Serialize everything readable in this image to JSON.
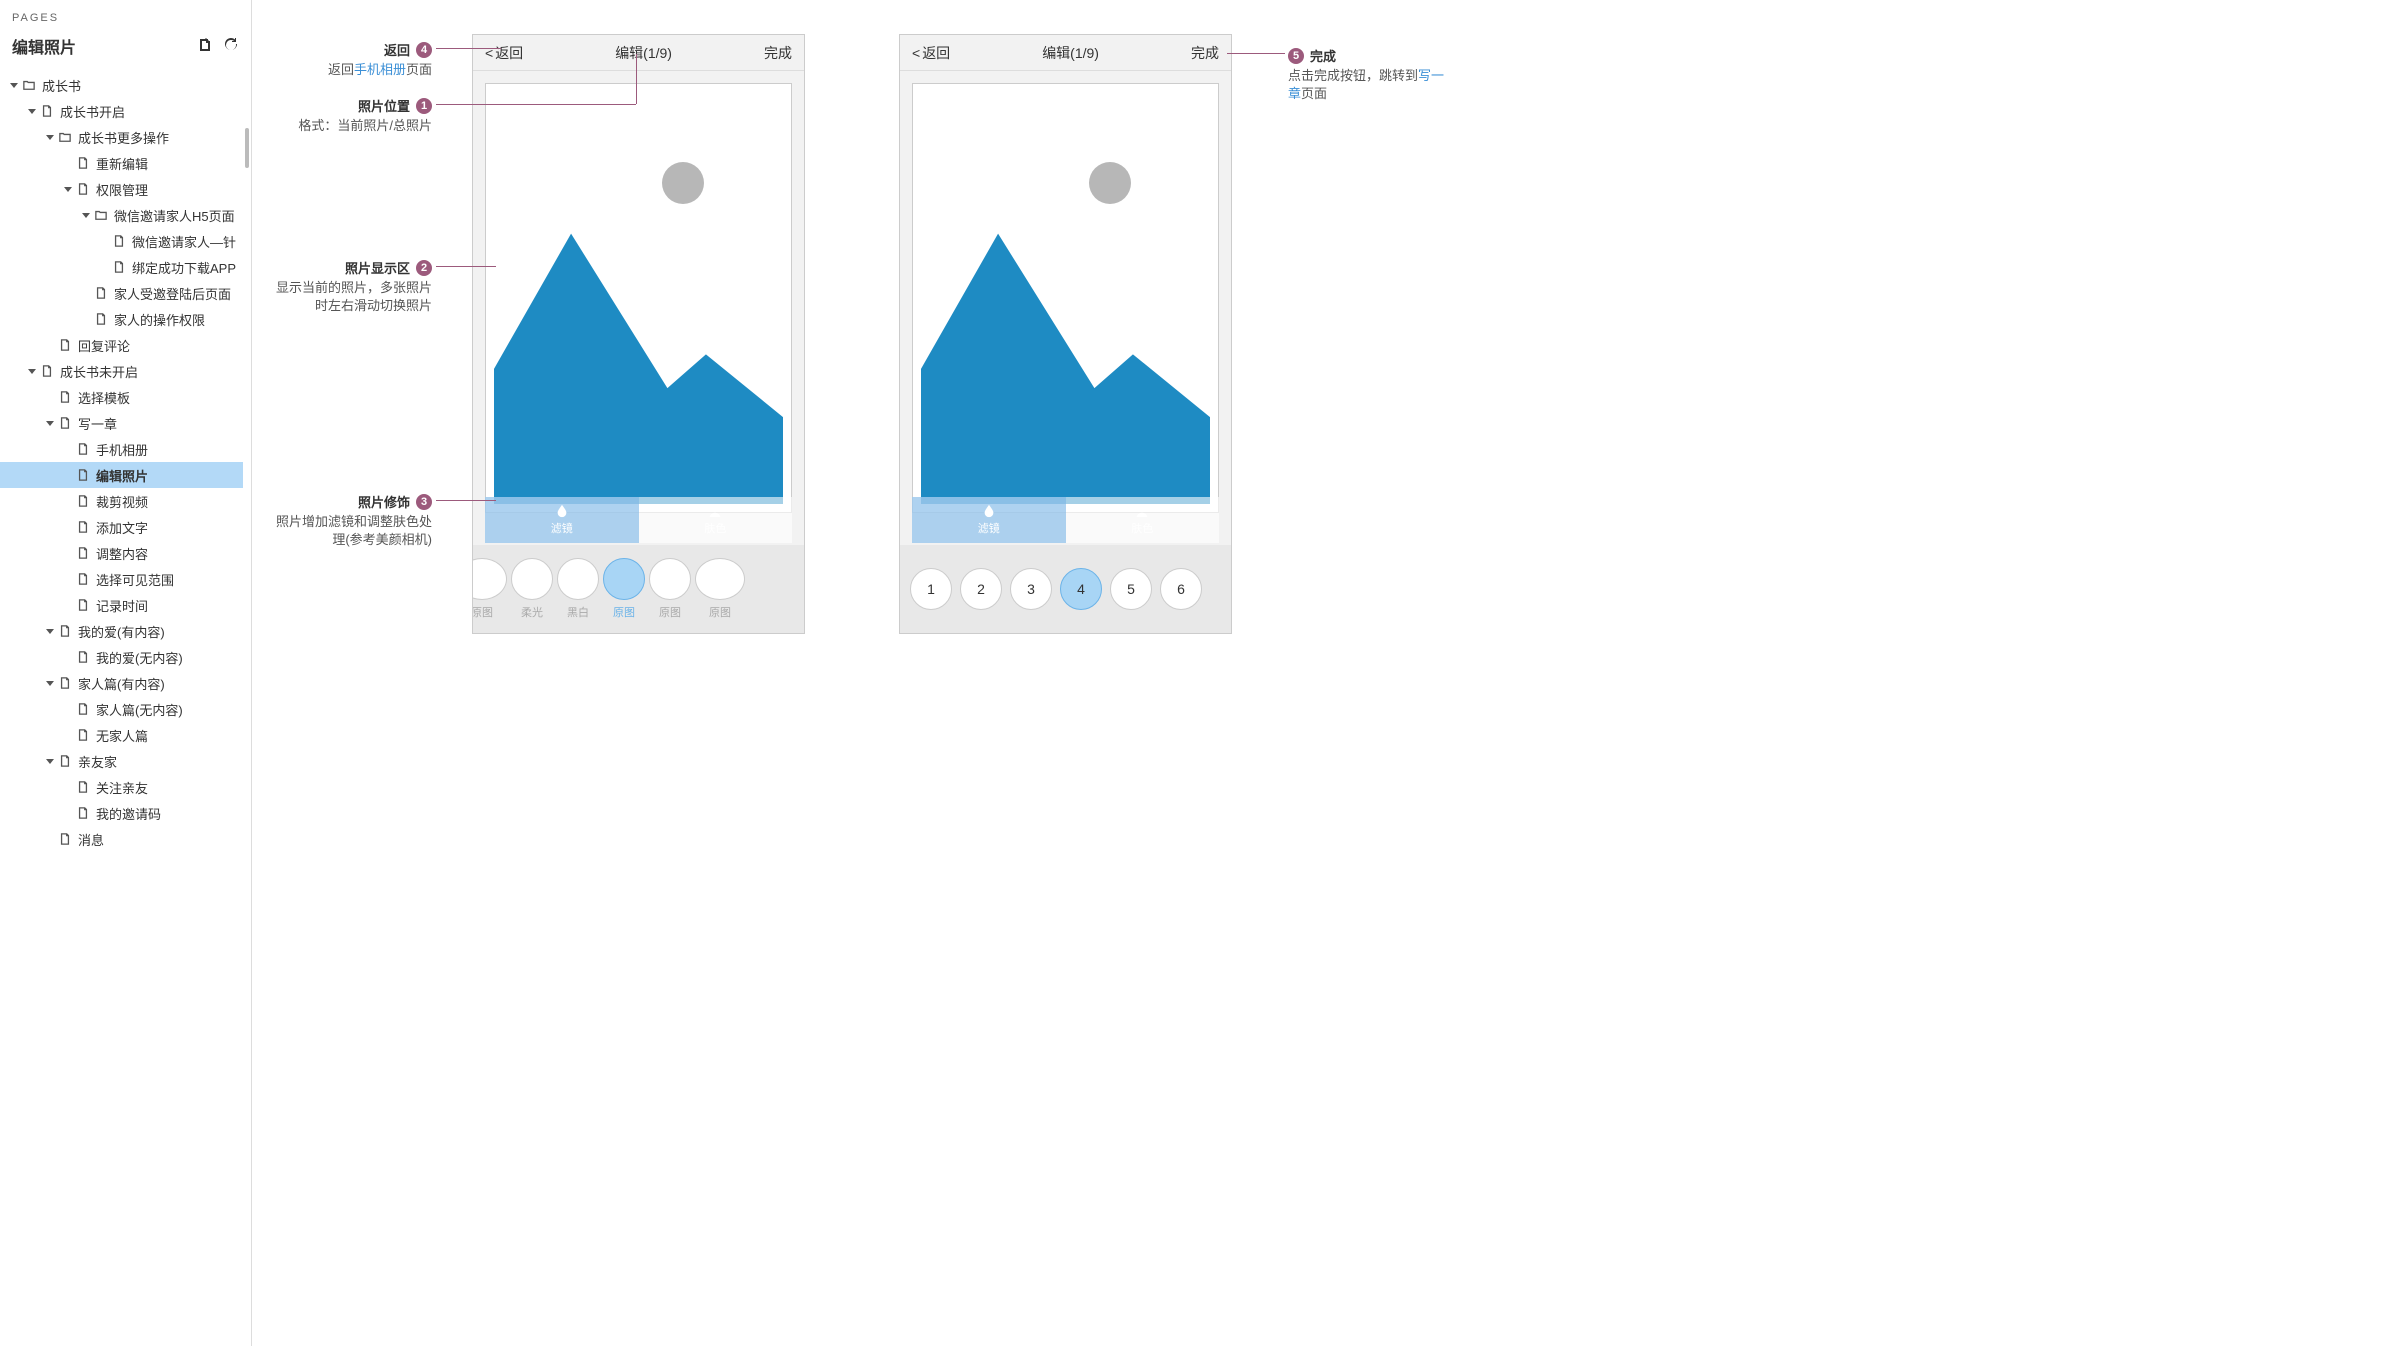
{
  "sidebar": {
    "header": "PAGES",
    "page_name": "编辑照片",
    "items": [
      {
        "depth": 0,
        "type": "folder",
        "exp": true,
        "label": "成长书"
      },
      {
        "depth": 1,
        "type": "page",
        "exp": true,
        "label": "成长书开启"
      },
      {
        "depth": 2,
        "type": "folder",
        "exp": true,
        "label": "成长书更多操作"
      },
      {
        "depth": 3,
        "type": "page",
        "label": "重新编辑"
      },
      {
        "depth": 3,
        "type": "page",
        "exp": true,
        "label": "权限管理"
      },
      {
        "depth": 4,
        "type": "folder",
        "exp": true,
        "label": "微信邀请家人H5页面"
      },
      {
        "depth": 5,
        "type": "page",
        "label": "微信邀请家人—针"
      },
      {
        "depth": 5,
        "type": "page",
        "label": "绑定成功下载APP"
      },
      {
        "depth": 4,
        "type": "page",
        "label": "家人受邀登陆后页面"
      },
      {
        "depth": 4,
        "type": "page",
        "label": "家人的操作权限"
      },
      {
        "depth": 2,
        "type": "page",
        "label": "回复评论"
      },
      {
        "depth": 1,
        "type": "page",
        "exp": true,
        "label": "成长书未开启"
      },
      {
        "depth": 2,
        "type": "page",
        "label": "选择模板"
      },
      {
        "depth": 2,
        "type": "page",
        "exp": true,
        "label": "写一章"
      },
      {
        "depth": 3,
        "type": "page",
        "label": "手机相册"
      },
      {
        "depth": 3,
        "type": "page",
        "label": "编辑照片",
        "selected": true
      },
      {
        "depth": 3,
        "type": "page",
        "label": "裁剪视频"
      },
      {
        "depth": 3,
        "type": "page",
        "label": "添加文字"
      },
      {
        "depth": 3,
        "type": "page",
        "label": "调整内容"
      },
      {
        "depth": 3,
        "type": "page",
        "label": "选择可见范围"
      },
      {
        "depth": 3,
        "type": "page",
        "label": "记录时间"
      },
      {
        "depth": 2,
        "type": "page",
        "exp": true,
        "label": "我的爱(有内容)"
      },
      {
        "depth": 3,
        "type": "page",
        "label": "我的爱(无内容)"
      },
      {
        "depth": 2,
        "type": "page",
        "exp": true,
        "label": "家人篇(有内容)"
      },
      {
        "depth": 3,
        "type": "page",
        "label": "家人篇(无内容)"
      },
      {
        "depth": 3,
        "type": "page",
        "label": "无家人篇"
      },
      {
        "depth": 2,
        "type": "page",
        "exp": true,
        "label": "亲友家"
      },
      {
        "depth": 3,
        "type": "page",
        "label": "关注亲友"
      },
      {
        "depth": 3,
        "type": "page",
        "label": "我的邀请码"
      },
      {
        "depth": 2,
        "type": "page",
        "label": "消息"
      }
    ]
  },
  "mockups": {
    "back": "返回",
    "title": "编辑(1/9)",
    "done": "完成",
    "tabs": {
      "filter": "滤镜",
      "skin": "肤色"
    },
    "phone1_thumbs": [
      {
        "label": "原图"
      },
      {
        "label": "柔光"
      },
      {
        "label": "黑白"
      },
      {
        "label": "原图",
        "active": true
      },
      {
        "label": "原图"
      },
      {
        "label": "原图"
      }
    ],
    "phone2_thumbs": [
      {
        "num": "1"
      },
      {
        "num": "2"
      },
      {
        "num": "3"
      },
      {
        "num": "4",
        "active": true
      },
      {
        "num": "5"
      },
      {
        "num": "6"
      }
    ]
  },
  "annotations": {
    "a4": {
      "title": "返回",
      "desc_pre": "返回",
      "link": "手机相册",
      "desc_post": "页面"
    },
    "a1": {
      "title": "照片位置",
      "desc": "格式：当前照片/总照片"
    },
    "a2": {
      "title": "照片显示区",
      "desc": "显示当前的照片，多张照片时左右滑动切换照片"
    },
    "a3": {
      "title": "照片修饰",
      "desc": "照片增加滤镜和调整肤色处理(参考美颜相机)"
    },
    "a5": {
      "title": "完成",
      "desc_pre": "点击完成按钮，跳转到",
      "link": "写一章",
      "desc_post": "页面"
    }
  }
}
